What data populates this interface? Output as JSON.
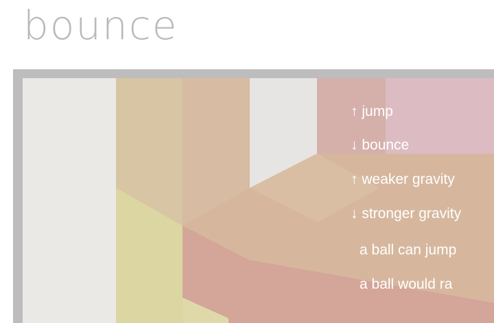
{
  "app": {
    "title": "bounce"
  },
  "game": {
    "controls": [
      {
        "arrow": "↑",
        "label": "jump"
      },
      {
        "arrow": "↓",
        "label": "bounce"
      },
      {
        "arrow": "↑",
        "label": "weaker gravity"
      },
      {
        "arrow": "↓",
        "label": "stronger gravity"
      }
    ],
    "notes": [
      "a ball can jump",
      "a ball would ra"
    ]
  },
  "colors": {
    "frame": "#bdbdbd",
    "paper": "#e9e7e4",
    "sand": "#d7c4a0",
    "tan": "#d6b9a0",
    "rose": "#d5b0ab",
    "pink": "#dcbcc0",
    "yellow": "#dbd6a1",
    "salmon": "#d4a498",
    "peach": "#d4b49c"
  }
}
